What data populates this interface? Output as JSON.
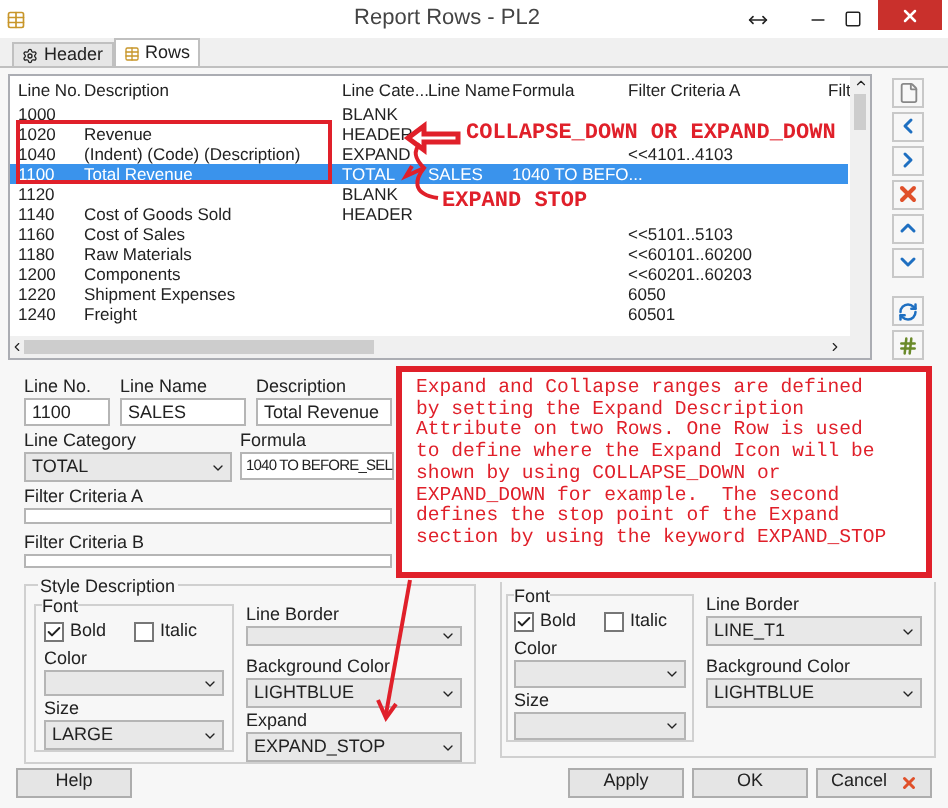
{
  "window": {
    "title": "Report Rows - PL2"
  },
  "tabs": [
    {
      "label": "Header",
      "selected": false,
      "kind": "header"
    },
    {
      "label": "Rows",
      "selected": true,
      "kind": "rows"
    }
  ],
  "table": {
    "columns": [
      "Line No.",
      "Description",
      "Line Cate...",
      "Line Name",
      "Formula",
      "Filter Criteria A",
      "Filt"
    ],
    "rows": [
      {
        "cells": [
          "1000",
          "",
          "BLANK",
          "",
          "",
          ""
        ],
        "selected": false
      },
      {
        "cells": [
          "1020",
          "Revenue",
          "HEADER",
          "",
          "",
          ""
        ],
        "selected": false
      },
      {
        "cells": [
          "1040",
          "(Indent) (Code) (Description)",
          "EXPAND",
          "",
          "",
          "<<4101..4103"
        ],
        "selected": false
      },
      {
        "cells": [
          "1100",
          "Total Revenue",
          "TOTAL",
          "SALES",
          "1040 TO BEFO...",
          ""
        ],
        "selected": true
      },
      {
        "cells": [
          "1120",
          "",
          "BLANK",
          "",
          "",
          ""
        ],
        "selected": false
      },
      {
        "cells": [
          "1140",
          "Cost of Goods Sold",
          "HEADER",
          "",
          "",
          ""
        ],
        "selected": false
      },
      {
        "cells": [
          "1160",
          "Cost of Sales",
          "",
          "",
          "",
          "<<5101..5103"
        ],
        "selected": false
      },
      {
        "cells": [
          "1180",
          "Raw Materials",
          "",
          "",
          "",
          "<<60101..60200"
        ],
        "selected": false
      },
      {
        "cells": [
          "1200",
          "Components",
          "",
          "",
          "",
          "<<60201..60203"
        ],
        "selected": false
      },
      {
        "cells": [
          "1220",
          "Shipment Expenses",
          "",
          "",
          "",
          "6050"
        ],
        "selected": false
      },
      {
        "cells": [
          "1240",
          "Freight",
          "",
          "",
          "",
          "60501"
        ],
        "selected": false
      }
    ]
  },
  "form": {
    "line_no": {
      "label": "Line No.",
      "value": "1100"
    },
    "line_name": {
      "label": "Line Name",
      "value": "SALES"
    },
    "description": {
      "label": "Description",
      "value": "Total Revenue"
    },
    "line_category": {
      "label": "Line Category",
      "value": "TOTAL"
    },
    "formula": {
      "label": "Formula",
      "value": "1040 TO BEFORE_SEL"
    },
    "filter_a": {
      "label": "Filter Criteria A"
    },
    "filter_b": {
      "label": "Filter Criteria B"
    }
  },
  "style_description": {
    "title": "Style Description",
    "font_label": "Font",
    "bold": {
      "label": "Bold",
      "checked": true
    },
    "italic": {
      "label": "Italic",
      "checked": false
    },
    "color": {
      "label": "Color"
    },
    "size": {
      "label": "Size",
      "value": "LARGE"
    },
    "line_border": {
      "label": "Line Border"
    },
    "background_color": {
      "label": "Background Color",
      "value": "LIGHTBLUE"
    },
    "expand": {
      "label": "Expand",
      "value": "EXPAND_STOP"
    }
  },
  "style_group_2": {
    "font_label": "Font",
    "bold": {
      "label": "Bold",
      "checked": true
    },
    "italic": {
      "label": "Italic",
      "checked": false
    },
    "color": {
      "label": "Color"
    },
    "size": {
      "label": "Size"
    },
    "line_border": {
      "label": "Line Border",
      "value": "LINE_T1"
    },
    "background_color": {
      "label": "Background Color",
      "value": "LIGHTBLUE"
    }
  },
  "buttons": [
    {
      "label": "Help",
      "kind": "help"
    },
    {
      "label": "Apply",
      "kind": "plain"
    },
    {
      "label": "OK",
      "kind": "plain"
    },
    {
      "label": "Cancel",
      "kind": "cancel"
    }
  ],
  "annotations": {
    "note": "Expand and Collapse ranges are defined\nby setting the Expand Description\nAttribute on two Rows. One Row is used\nto define where the Expand Icon will be\nshown by using COLLAPSE_DOWN or\nEXPAND_DOWN for example.  The second\ndefines the stop point of the Expand\nsection by using the keyword EXPAND_STOP",
    "callout_top": "COLLAPSE_DOWN OR EXPAND_DOWN",
    "callout_bottom": "EXPAND STOP"
  }
}
